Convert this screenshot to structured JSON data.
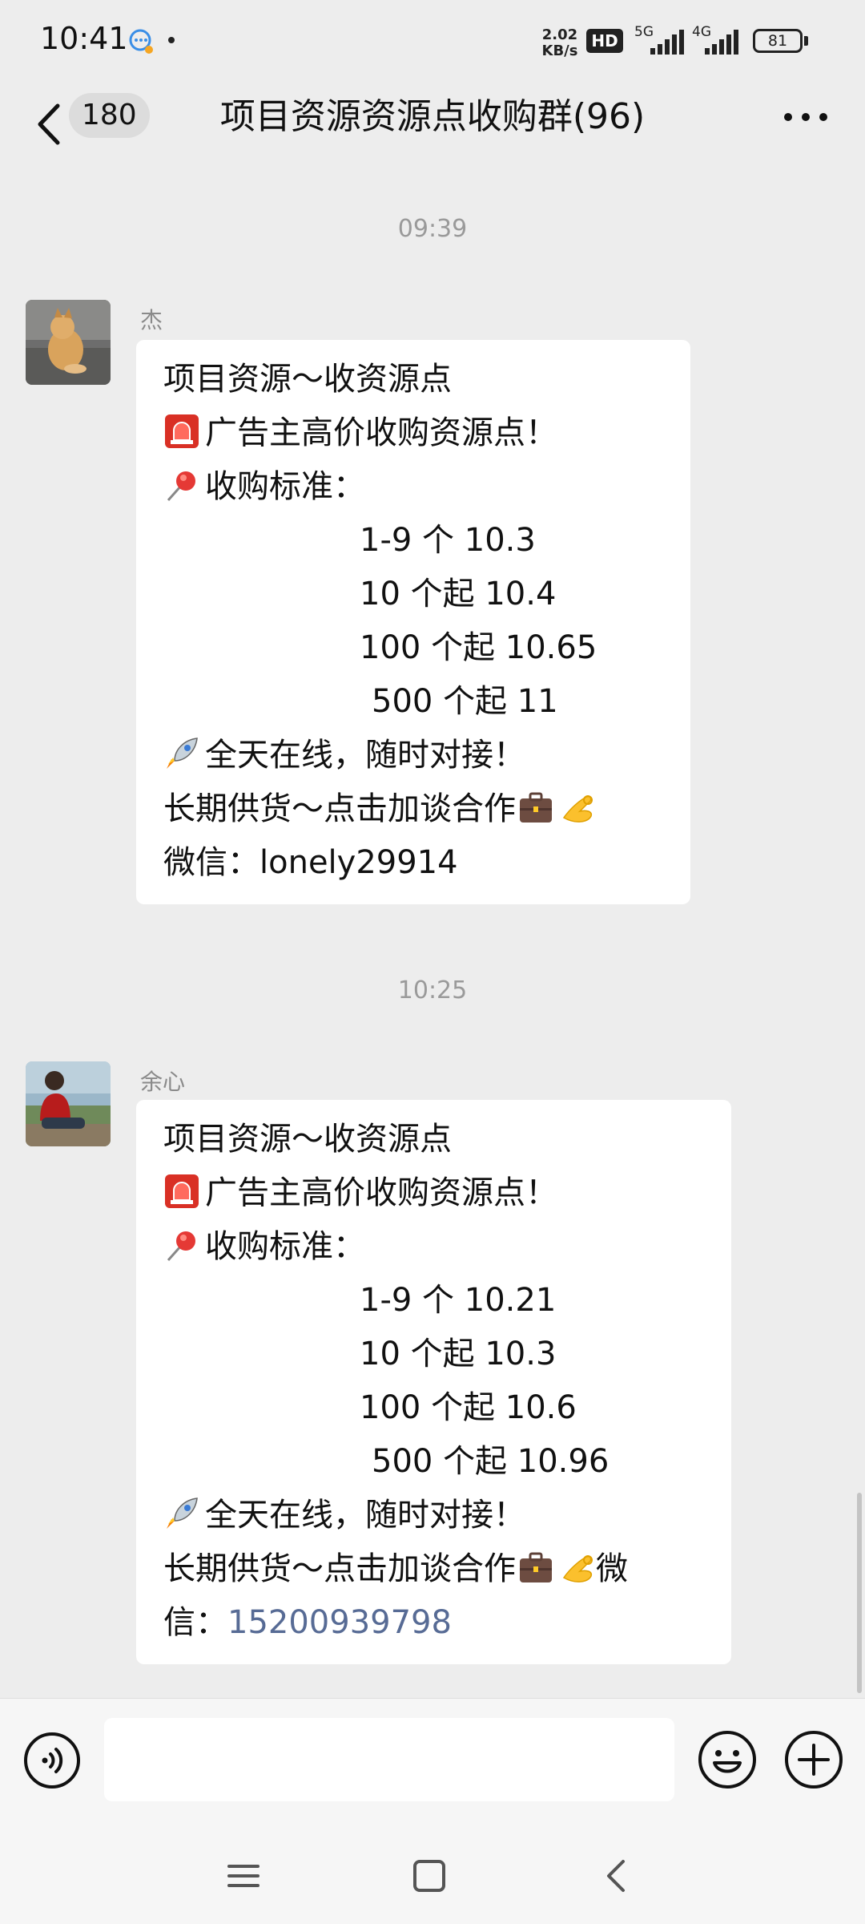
{
  "status_bar": {
    "time": "10:41",
    "net_speed_value": "2.02",
    "net_speed_unit": "KB/s",
    "hd_label": "HD",
    "network_1": "5G",
    "network_2": "4G",
    "battery": "81",
    "icons": [
      "chat-bubble-icon",
      "signal-bars-icon",
      "battery-icon"
    ]
  },
  "header": {
    "back_count": "180",
    "title": "项目资源资源点收购群(96)",
    "icons": [
      "back-arrow-icon",
      "more-dots-icon"
    ]
  },
  "messages": [
    {
      "timestamp": "09:39",
      "sender": "杰",
      "lines": [
        {
          "text": "项目资源～收资源点"
        },
        {
          "emoji": "siren",
          "text": "广告主高价收购资源点！"
        },
        {
          "emoji": "pushpin",
          "text": "收购标准："
        },
        {
          "text": "1-9 个 10.3"
        },
        {
          "text": "10 个起 10.4"
        },
        {
          "text": "100 个起 10.65"
        },
        {
          "text": "500 个起 11"
        },
        {
          "emoji": "rocket",
          "text": "全天在线，随时对接！"
        },
        {
          "text": "长期供货～点击加谈合作"
        },
        {
          "text_pre": "微信：",
          "text": "lonely29914"
        }
      ]
    },
    {
      "timestamp": "10:25",
      "sender": "余心",
      "lines": [
        {
          "text": "项目资源～收资源点"
        },
        {
          "emoji": "siren",
          "text": "广告主高价收购资源点！"
        },
        {
          "emoji": "pushpin",
          "text": "收购标准："
        },
        {
          "text": "1-9 个 10.21"
        },
        {
          "text": "10 个起 10.3"
        },
        {
          "text": "100 个起 10.6"
        },
        {
          "text": "500 个起 10.96"
        },
        {
          "emoji": "rocket",
          "text": "全天在线，随时对接！"
        },
        {
          "text": "长期供货～点击加谈合作",
          "text_post": "微"
        },
        {
          "text_pre": "信：",
          "text": "15200939798"
        }
      ]
    }
  ],
  "input_bar": {
    "placeholder": "",
    "icons": [
      "voice-icon",
      "emoji-face-icon",
      "plus-icon"
    ]
  },
  "nav_bar": {
    "icons": [
      "menu-icon",
      "home-square-icon",
      "back-triangle-icon"
    ]
  },
  "colors": {
    "background": "#ededed",
    "bubble": "#ffffff",
    "link": "#576b95",
    "timestamp": "#9a9a9a"
  }
}
